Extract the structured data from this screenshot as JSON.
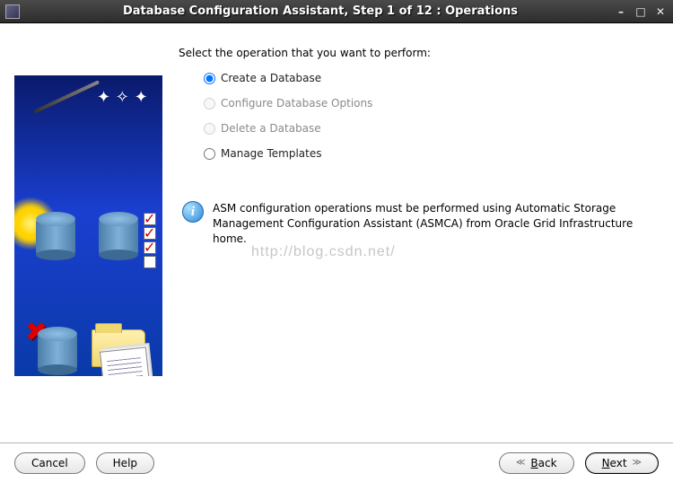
{
  "window": {
    "title": "Database Configuration Assistant, Step 1 of 12 : Operations"
  },
  "prompt": "Select the operation that you want to perform:",
  "options": {
    "create": "Create a Database",
    "configure": "Configure Database Options",
    "delete": "Delete a Database",
    "manage": "Manage Templates"
  },
  "info": {
    "text": "ASM configuration operations must be performed using Automatic Storage Management Configuration Assistant (ASMCA) from Oracle Grid Infrastructure home."
  },
  "watermark": "http://blog.csdn.net/",
  "buttons": {
    "cancel": "Cancel",
    "help": "Help",
    "back": "Back",
    "next": "Next"
  }
}
